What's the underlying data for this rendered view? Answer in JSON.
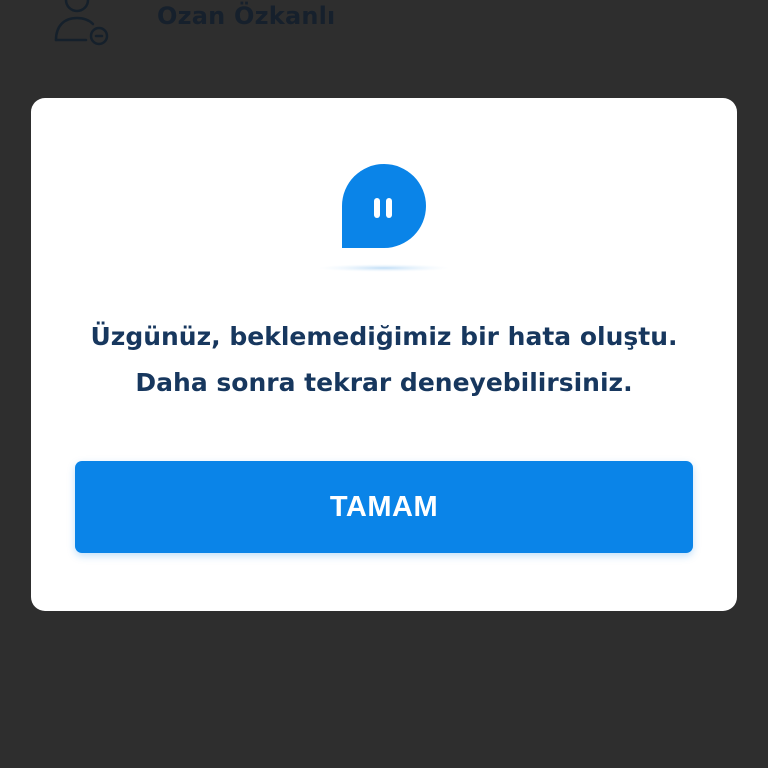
{
  "background": {
    "user_name": "Ozan Özkanlı"
  },
  "dialog": {
    "icon": "pause-chat-bubble-icon",
    "message_line1": "Üzgünüz, beklemediğimiz bir hata oluştu.",
    "message_line2": "Daha sonra tekrar deneyebilirsiniz.",
    "button_label": "TAMAM"
  },
  "colors": {
    "overlay": "#2e2e2e",
    "dialog": "#ffffff",
    "accent": "#0a84e8",
    "text": "#17375e"
  }
}
